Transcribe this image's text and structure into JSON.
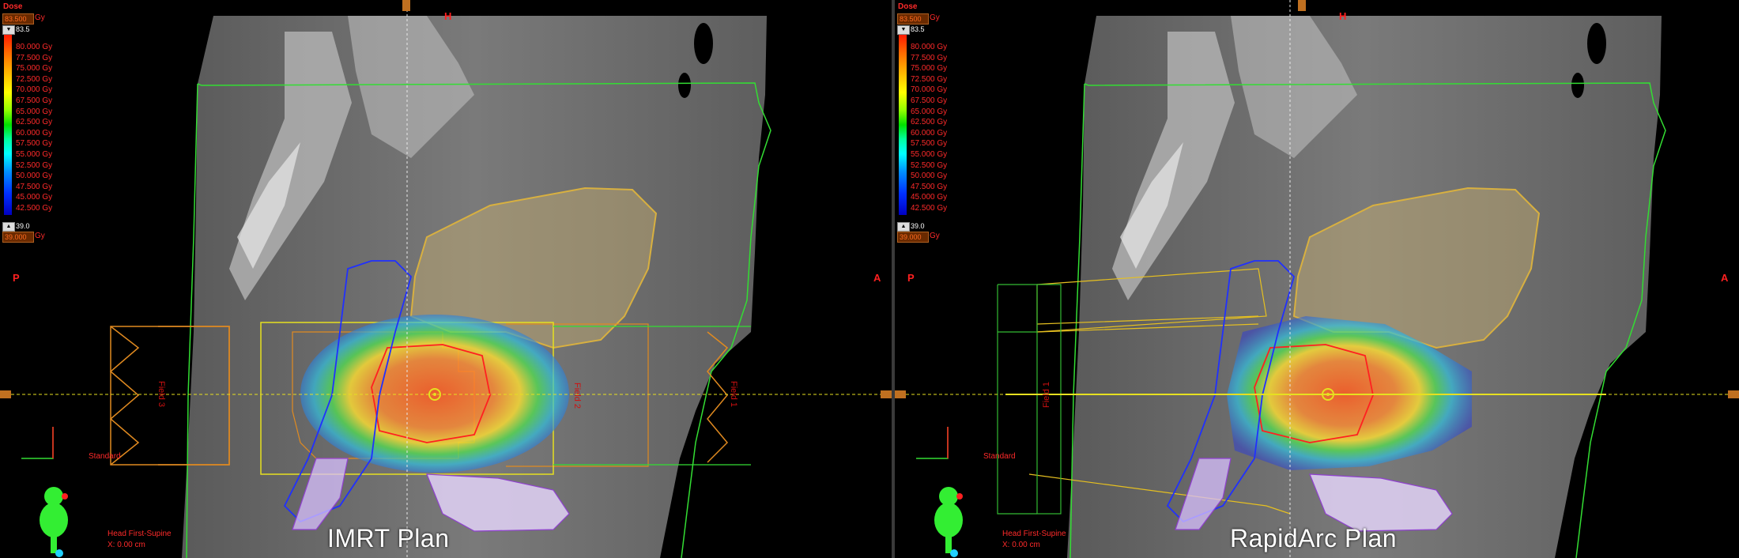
{
  "panels": [
    {
      "id": "left",
      "dose_title": "Dose",
      "max_box": "83.500",
      "min_box": "39.000",
      "unit": "Gy",
      "max_value": "83.5",
      "min_value": "39.0",
      "dose_levels": [
        "80.000 Gy",
        "77.500 Gy",
        "75.000 Gy",
        "72.500 Gy",
        "70.000 Gy",
        "67.500 Gy",
        "65.000 Gy",
        "62.500 Gy",
        "60.000 Gy",
        "57.500 Gy",
        "55.000 Gy",
        "52.500 Gy",
        "50.000 Gy",
        "47.500 Gy",
        "45.000 Gy",
        "42.500 Gy"
      ],
      "orient_top": "H",
      "orient_left": "P",
      "orient_right": "A",
      "standard_label": "Standard",
      "patient_position": "Head First-Supine",
      "coordinate": "X: 0.00 cm",
      "plan_label": "IMRT Plan",
      "field_labels": [
        "Field 3",
        "Field 2",
        "Field 1"
      ]
    },
    {
      "id": "right",
      "dose_title": "Dose",
      "max_box": "83.500",
      "min_box": "39.000",
      "unit": "Gy",
      "max_value": "83.5",
      "min_value": "39.0",
      "dose_levels": [
        "80.000 Gy",
        "77.500 Gy",
        "75.000 Gy",
        "72.500 Gy",
        "70.000 Gy",
        "67.500 Gy",
        "65.000 Gy",
        "62.500 Gy",
        "60.000 Gy",
        "57.500 Gy",
        "55.000 Gy",
        "52.500 Gy",
        "50.000 Gy",
        "47.500 Gy",
        "45.000 Gy",
        "42.500 Gy"
      ],
      "orient_top": "H",
      "orient_left": "P",
      "orient_right": "A",
      "standard_label": "Standard",
      "patient_position": "Head First-Supine",
      "coordinate": "X: 0.00 cm",
      "plan_label": "RapidArc Plan",
      "field_labels": [
        "Field 1"
      ]
    }
  ],
  "colors": {
    "text_red": "#ff2a2a",
    "body_contour": "#33dd33",
    "bladder": "#d8b040",
    "rectum": "#2030ff",
    "ptv": "#ff2020",
    "field_orange": "#e08a20",
    "field_yellow": "#e6e020"
  }
}
